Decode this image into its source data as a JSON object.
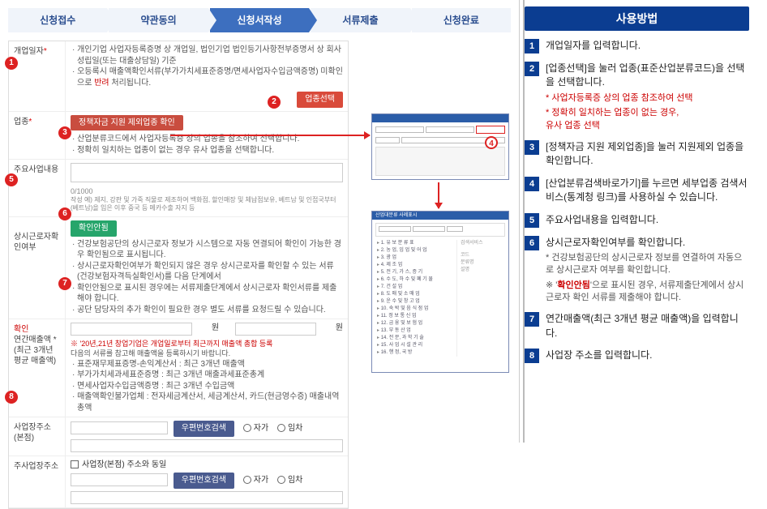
{
  "stepper": [
    "신청접수",
    "약관동의",
    "신청서작성",
    "서류제출",
    "신청완료"
  ],
  "stepper_active_index": 2,
  "form": {
    "r1_label": "개업일자",
    "r1_b1": "개인기업 사업자등록증명 상 개업일, 법인기업 법인등기사항전부증명서 상 회사성립일(또는 대출상담일) 기준",
    "r1_b2": "오등록시 매출액확인서류(부가가치세표준증명/면세사업자수입금액증명) 미확인으로 반려 처리됩니다.",
    "r1_b2_red": "반려",
    "r2_label": "업종",
    "r2_btn": "업종선택",
    "r2_red_btn": "정책자금 지원 제외업종 확인",
    "r2_b1": "산업분류코드에서 사업자등록증 상의 업종을 참조하여 선택합니다.",
    "r2_b2": "정확히 일치하는 업종이 없는 경우 유사 업종을 선택합니다.",
    "r3_label": "주요사업내용",
    "r3_count": "0/1000",
    "r3_hint": "작성 예) 제지, 강판 및 가죽 직물로 제조하여 백화점, 할인매장 및 체납점보유, 베트남 및 인접국부터(베트남)을 입은 이후 중국 등 메카수출 자지 등",
    "r4_label": "상시근로자확인여부",
    "r4_badge": "확인안됨",
    "r4_b1": "건강보험공단의 상시근로자 정보가 시스템으로 자동 연결되어 확인이 가능한 경우 확인됨으로 표시됩니다.",
    "r4_b2": "상시근로자확인여부가 확인되지 않은 경우 상시근로자를 확인할 수 있는 서류(건강보험자격득실확인서)를 다음 단계에서",
    "r4_b3": "확인안됨으로 표시된 경우에는 서류제출단계에서 상시근로자 확인서류를 제출해야 합니다.",
    "r4_b4": "공단 담당자의 추가 확인이 필요한 경우 별도 서류를 요청드릴 수 있습니다.",
    "r5_label": "연간매출액 *\n(최근 3개년 평균 매출액)",
    "r5_won": "원",
    "r5_won2": "원",
    "r5_red": "※ '20년,21년 창업기업은 개업일로부터 최근까지 매출액 총합 등록",
    "r5_l0": "다음의 서류를 참고해 매출액을 등록하시기 바랍니다.",
    "r5_l1": "표준재무제표증명-손익계산서 : 최근 3개년 매출액",
    "r5_l2": "부가가치세과세표준증명 : 최근 3개년 매출과세표준총계",
    "r5_l3": "면세사업자수입금액증명 : 최근 3개년 수입금액",
    "r5_l4": "매출액확인불가업체 : 전자세금계산서, 세금계산서, 카드(현금영수증) 매출내역 총액",
    "r6_label": "사업장주소(본점)",
    "r6_btn": "우편번호검색",
    "r6_r1": "자가",
    "r6_r2": "임차",
    "r7_chk": "사업장(본점) 주소와 동일",
    "r7_label": "주사업장주소",
    "r7_btn": "우편번호검색",
    "r7_r1": "자가",
    "r7_r2": "임차",
    "modal2_title": "산업대분류 사례표시"
  },
  "right": {
    "title": "사용방법",
    "items": [
      {
        "n": "1",
        "t": "개업일자를 입력합니다."
      },
      {
        "n": "2",
        "t": "[업종선택]을 눌러 업종(표준산업분류코드)을 선택을 선택합니다.",
        "sub": [
          "* 사업자등록증 상의 업종 참조하여 선택",
          "* 정확히 일치하는 업종이 없는 경우,\n  유사 업종 선택"
        ]
      },
      {
        "n": "3",
        "t": "[정책자금 지원 제외업종]을 눌러 지원제외 업종을 확인합니다."
      },
      {
        "n": "4",
        "t": "[산업분류검색바로가기]를 누르면 세부업종 검색서비스(통계청 링크)를 사용하실 수 있습니다."
      },
      {
        "n": "5",
        "t": "주요사업내용을 입력합니다."
      },
      {
        "n": "6",
        "t": "상시근로자확인여부를 확인합니다.",
        "sub2": [
          "* 건강보험공단의 상시근로자 정보를 연결하여 자동으로 상시근로자 여부를 확인합니다.",
          "※ '<b>확인안됨</b>'으로 표시된 경우, 서류제출단계에서 상시근로자 확인 서류를 제출해야 합니다."
        ]
      },
      {
        "n": "7",
        "t": "연간매출액(최근 3개년 평균 매출액)을 입력합니다."
      },
      {
        "n": "8",
        "t": "사업장 주소를 입력합니다."
      }
    ]
  },
  "callouts": [
    "1",
    "2",
    "3",
    "4",
    "5",
    "6",
    "7",
    "8"
  ]
}
